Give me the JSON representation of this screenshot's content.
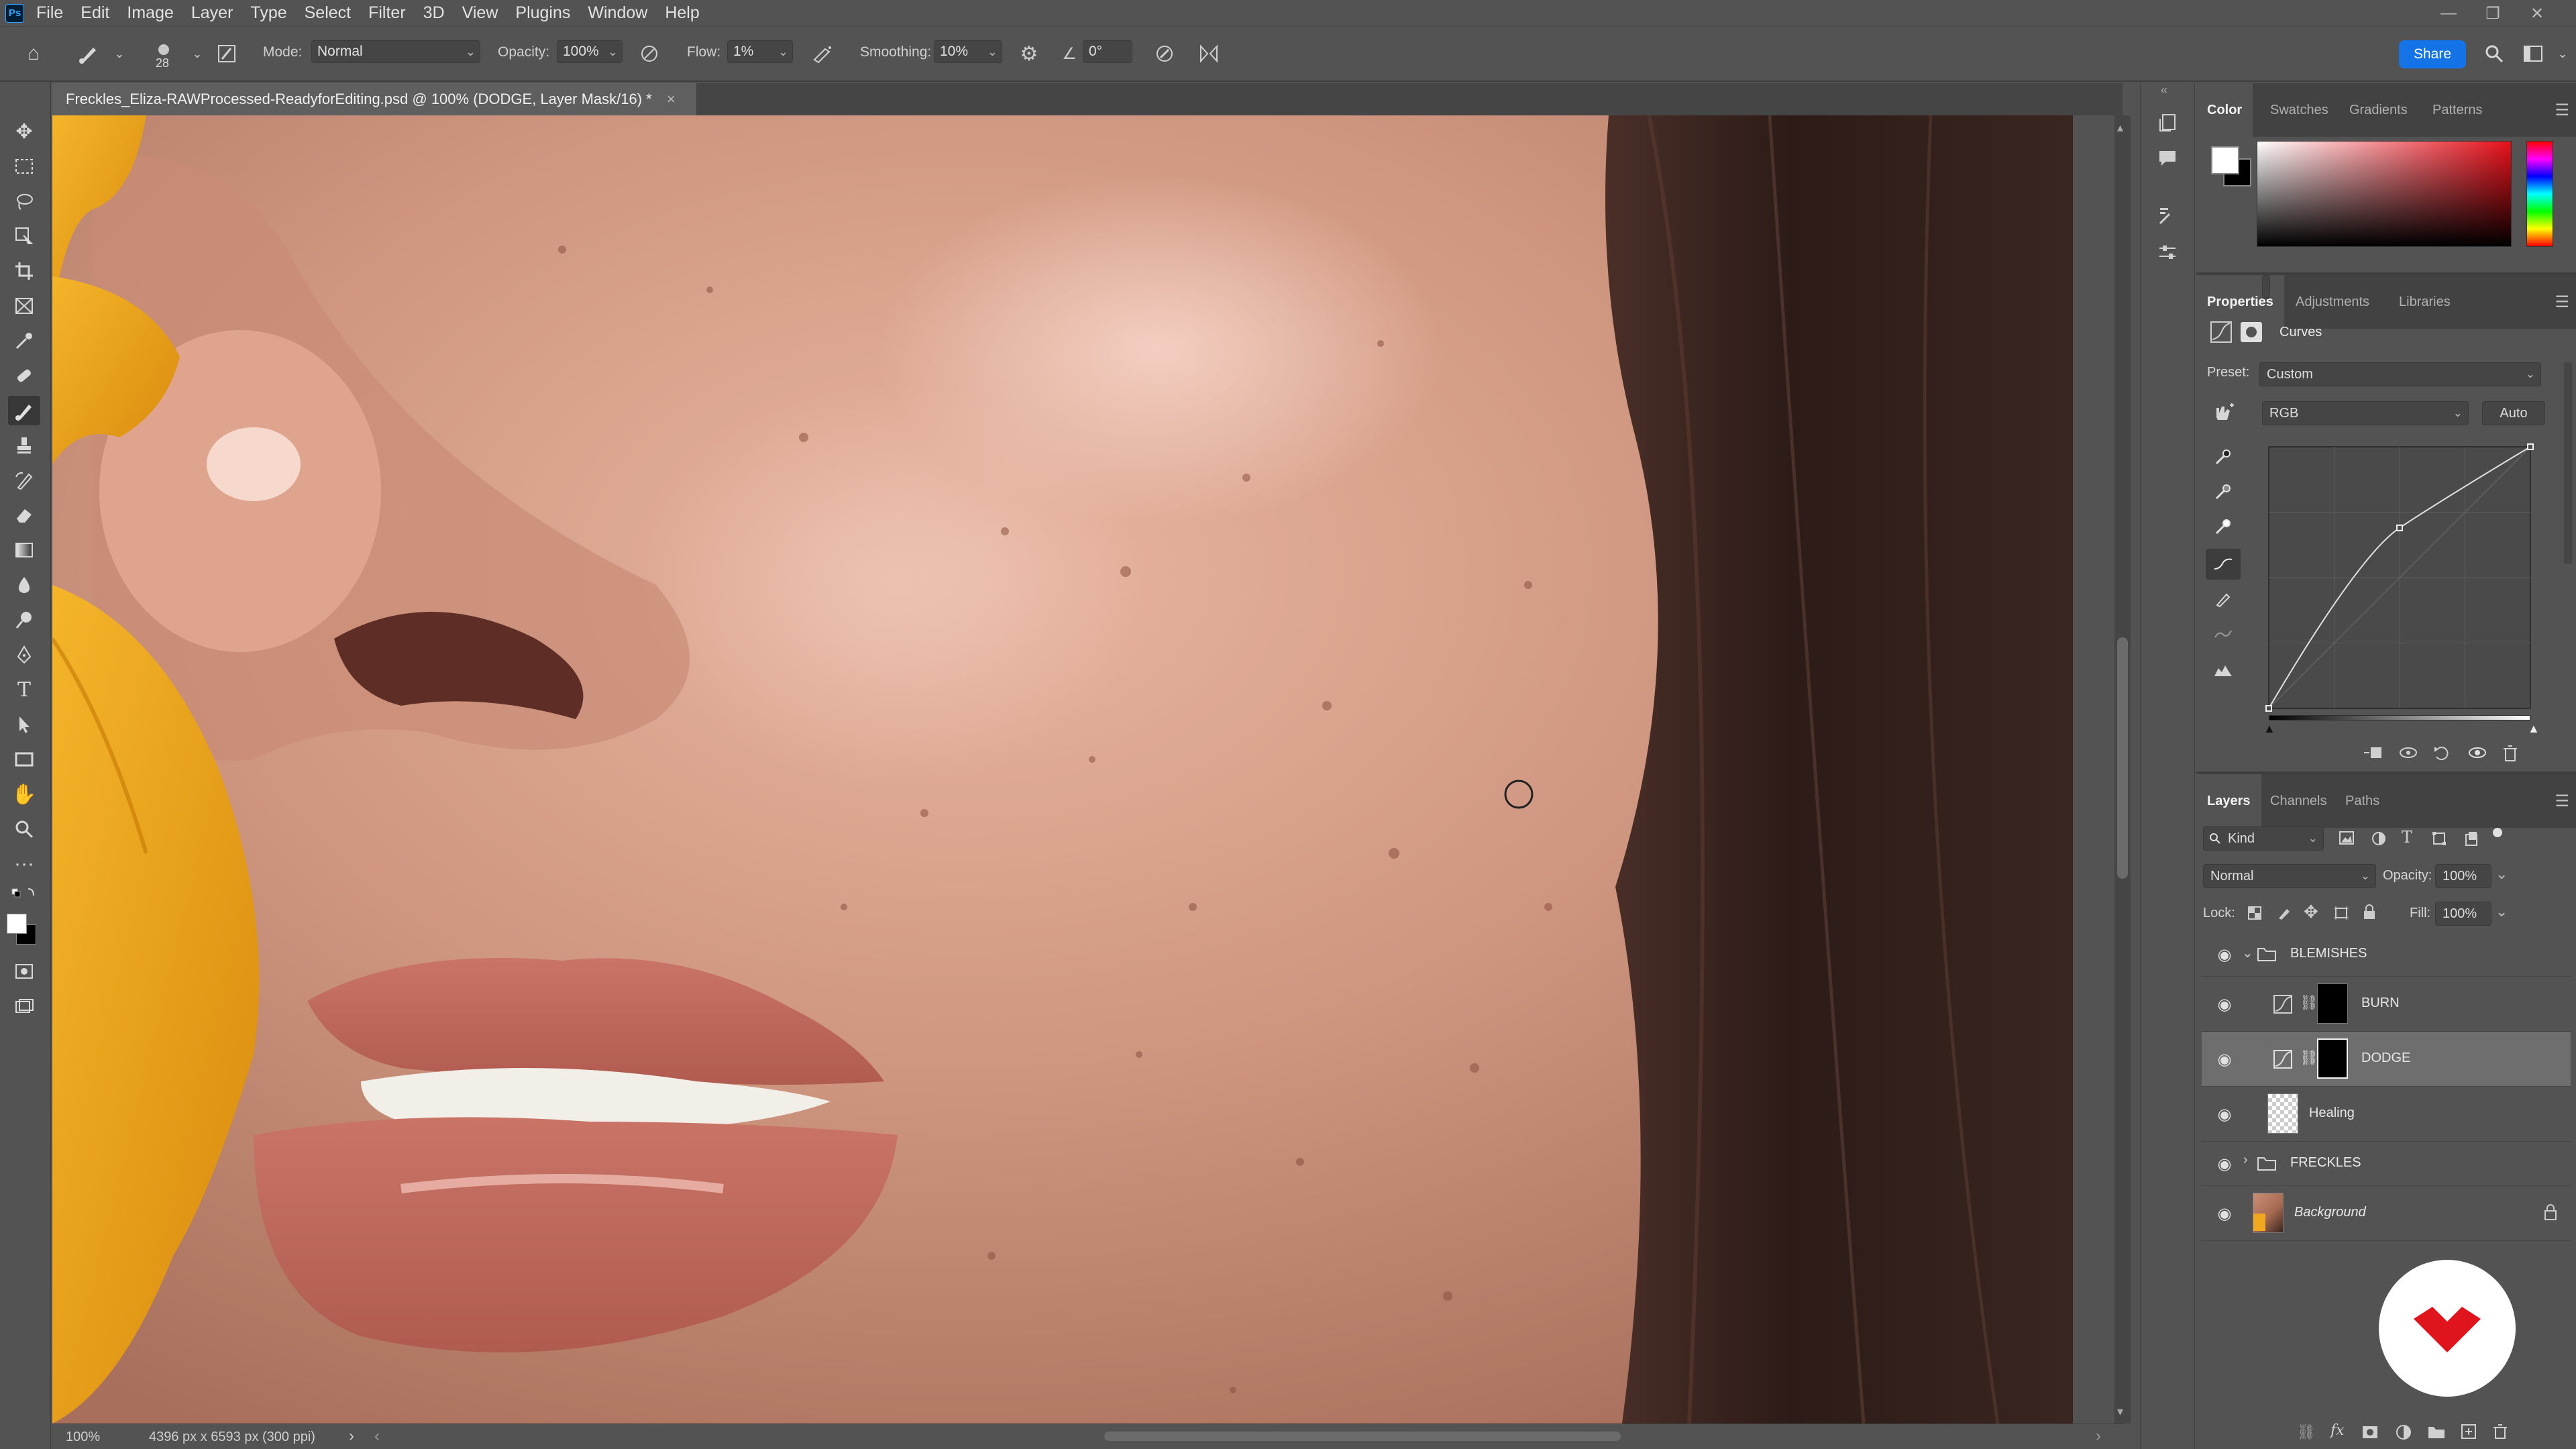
{
  "menubar": {
    "logo": "Ps",
    "items": [
      "File",
      "Edit",
      "Image",
      "Layer",
      "Type",
      "Select",
      "Filter",
      "3D",
      "View",
      "Plugins",
      "Window",
      "Help"
    ],
    "window_controls": [
      "—",
      "❐",
      "✕"
    ]
  },
  "options": {
    "brush_size": "28",
    "mode_label": "Mode:",
    "mode_value": "Normal",
    "opacity_label": "Opacity:",
    "opacity_value": "100%",
    "flow_label": "Flow:",
    "flow_value": "1%",
    "smoothing_label": "Smoothing:",
    "smoothing_value": "10%",
    "angle_value": "0°",
    "share_label": "Share"
  },
  "document": {
    "tab_title": "Freckles_Eliza-RAWProcessed-ReadyforEditing.psd @ 100% (DODGE, Layer Mask/16) *",
    "close": "×",
    "zoom": "100%",
    "dimensions": "4396 px x 6593 px (300 ppi)",
    "status_arrow": "›",
    "scroll_left": "‹",
    "scroll_right": "›"
  },
  "color_panel": {
    "tabs": [
      "Color",
      "Swatches",
      "Gradients",
      "Patterns"
    ],
    "active_tab": 0,
    "foreground": "#ffffff",
    "background": "#000000",
    "hue_accent": "#e8101a"
  },
  "properties_panel": {
    "tabs": [
      "Properties",
      "Adjustments",
      "Libraries"
    ],
    "active_tab": 0,
    "adjustment_name": "Curves",
    "preset_label": "Preset:",
    "preset_value": "Custom",
    "channel_value": "RGB",
    "auto_label": "Auto",
    "curve_points": [
      [
        0,
        0
      ],
      [
        0.5,
        0.69
      ],
      [
        1,
        1
      ]
    ]
  },
  "layers_panel": {
    "tabs": [
      "Layers",
      "Channels",
      "Paths"
    ],
    "active_tab": 0,
    "filter_kind": "Kind",
    "blend_mode": "Normal",
    "opacity_label": "Opacity:",
    "opacity_value": "100%",
    "lock_label": "Lock:",
    "fill_label": "Fill:",
    "fill_value": "100%",
    "layers": [
      {
        "name": "BLEMISHES",
        "kind": "group",
        "expanded": true,
        "visible": true
      },
      {
        "name": "BURN",
        "kind": "adjustment",
        "visible": true,
        "selected": false
      },
      {
        "name": "DODGE",
        "kind": "adjustment",
        "visible": true,
        "selected": true
      },
      {
        "name": "Healing",
        "kind": "pixel",
        "visible": true
      },
      {
        "name": "FRECKLES",
        "kind": "group",
        "expanded": false,
        "visible": true
      },
      {
        "name": "Background",
        "kind": "background",
        "visible": true,
        "locked": true
      }
    ]
  }
}
